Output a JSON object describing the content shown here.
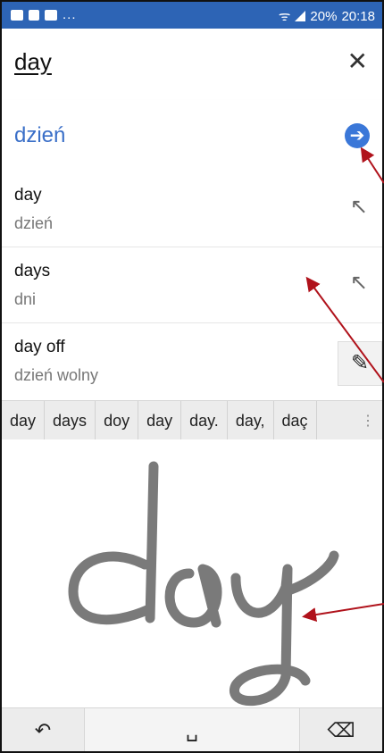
{
  "status_bar": {
    "left_text": "...",
    "right_text": "20% ",
    "time": "20:18"
  },
  "search": {
    "query": "day",
    "close_icon": "close-icon"
  },
  "translation": {
    "text": "dzień",
    "go_icon": "arrow-circle-right-icon"
  },
  "suggestions": [
    {
      "word": "day",
      "translation": "dzień"
    },
    {
      "word": "days",
      "translation": "dni"
    },
    {
      "word": "day off",
      "translation": "dzień wolny"
    }
  ],
  "candidates": [
    "day",
    "days",
    "doy",
    "day",
    "day.",
    "day,",
    "daç"
  ],
  "candidate_more_icon": "more-vertical-icon",
  "handwriting": {
    "pen_color": "#7a7a7a"
  },
  "keys": {
    "undo_icon": "undo-icon",
    "space_icon": "space-icon",
    "backspace_icon": "backspace-icon"
  },
  "colors": {
    "status_bar": "#2d64b5",
    "accent": "#3a6fc8",
    "annotation_arrow": "#b0121b"
  }
}
